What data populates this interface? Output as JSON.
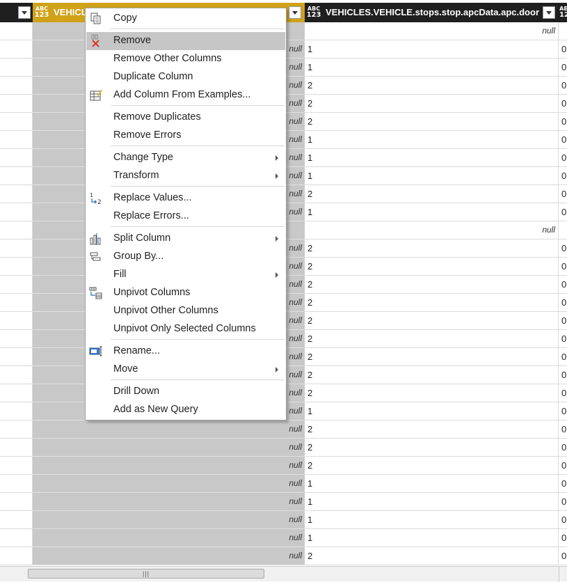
{
  "columns": [
    {
      "title": "VEHICLES.VEHICLE.stops.stop.apcData.apc.door",
      "type_top": "ABC",
      "type_bottom": "123"
    },
    {
      "title": "VEHICL",
      "type_top": "ABC",
      "type_bottom": "123"
    },
    {
      "title": "",
      "type_top": "AE",
      "type_bottom": "12"
    }
  ],
  "null_text": "null",
  "rows": [
    {
      "c1": "",
      "c2": "",
      "c2_null": true,
      "c3": ""
    },
    {
      "c1": "null",
      "c2": "1",
      "c3": "0"
    },
    {
      "c1": "null",
      "c2": "1",
      "c3": "0"
    },
    {
      "c1": "null",
      "c2": "2",
      "c3": "0"
    },
    {
      "c1": "null",
      "c2": "2",
      "c3": "0"
    },
    {
      "c1": "null",
      "c2": "2",
      "c3": "0"
    },
    {
      "c1": "null",
      "c2": "1",
      "c3": "0"
    },
    {
      "c1": "null",
      "c2": "1",
      "c3": "0"
    },
    {
      "c1": "null",
      "c2": "1",
      "c3": "0"
    },
    {
      "c1": "null",
      "c2": "2",
      "c3": "0"
    },
    {
      "c1": "null",
      "c2": "1",
      "c3": "0"
    },
    {
      "c1": "",
      "c2": "",
      "c2_null": true,
      "c3": ""
    },
    {
      "c1": "null",
      "c2": "2",
      "c3": "0"
    },
    {
      "c1": "null",
      "c2": "2",
      "c3": "0"
    },
    {
      "c1": "null",
      "c2": "2",
      "c3": "0"
    },
    {
      "c1": "null",
      "c2": "2",
      "c3": "0"
    },
    {
      "c1": "null",
      "c2": "2",
      "c3": "0"
    },
    {
      "c1": "null",
      "c2": "2",
      "c3": "0"
    },
    {
      "c1": "null",
      "c2": "2",
      "c3": "0"
    },
    {
      "c1": "null",
      "c2": "2",
      "c3": "0"
    },
    {
      "c1": "null",
      "c2": "2",
      "c3": "0"
    },
    {
      "c1": "null",
      "c2": "1",
      "c3": "0"
    },
    {
      "c1": "null",
      "c2": "2",
      "c3": "0"
    },
    {
      "c1": "null",
      "c2": "2",
      "c3": "0"
    },
    {
      "c1": "null",
      "c2": "2",
      "c3": "0"
    },
    {
      "c1": "null",
      "c2": "1",
      "c3": "0"
    },
    {
      "c1": "null",
      "c2": "1",
      "c3": "0"
    },
    {
      "c1": "null",
      "c2": "1",
      "c3": "0"
    },
    {
      "c1": "null",
      "c2": "1",
      "c3": "0"
    },
    {
      "c1": "null",
      "c2": "2",
      "c3": "0"
    }
  ],
  "context_menu": {
    "items": [
      {
        "label": "Copy",
        "icon": "copy-icon"
      },
      {
        "label": "Remove",
        "icon": "remove-icon",
        "highlighted": true
      },
      {
        "label": "Remove Other Columns"
      },
      {
        "label": "Duplicate Column"
      },
      {
        "label": "Add Column From Examples...",
        "icon": "add-column-from-examples-icon"
      },
      {
        "label": "Remove Duplicates"
      },
      {
        "label": "Remove Errors"
      },
      {
        "label": "Change Type",
        "submenu": true
      },
      {
        "label": "Transform",
        "submenu": true
      },
      {
        "label": "Replace Values...",
        "icon": "replace-values-icon"
      },
      {
        "label": "Replace Errors..."
      },
      {
        "label": "Split Column",
        "icon": "split-column-icon",
        "submenu": true
      },
      {
        "label": "Group By...",
        "icon": "group-by-icon"
      },
      {
        "label": "Fill",
        "submenu": true
      },
      {
        "label": "Unpivot Columns",
        "icon": "unpivot-icon"
      },
      {
        "label": "Unpivot Other Columns"
      },
      {
        "label": "Unpivot Only Selected Columns"
      },
      {
        "label": "Rename...",
        "icon": "rename-icon"
      },
      {
        "label": "Move",
        "submenu": true
      },
      {
        "label": "Drill Down"
      },
      {
        "label": "Add as New Query"
      }
    ],
    "replace_icon_glyph_top": "1",
    "replace_icon_glyph_bottom": "2"
  },
  "colors": {
    "selected_header": "#cfa21a",
    "header": "#1f1f1f",
    "selected_column": "#c8c8c8",
    "menu_highlight": "#c6c6c6"
  }
}
